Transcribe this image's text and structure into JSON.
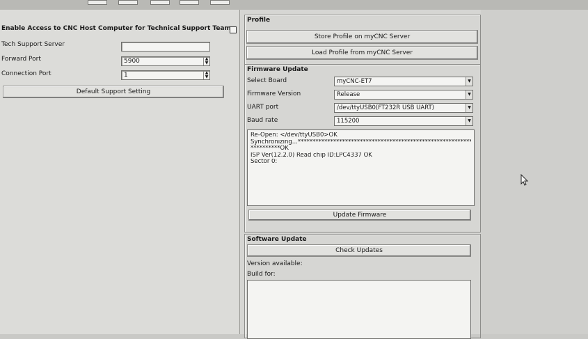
{
  "support": {
    "enable_label": "Enable Access to CNC Host Computer for Technical Support Team",
    "tech_server_label": "Tech Support Server",
    "tech_server_value": "",
    "forward_port_label": "Forward Port",
    "forward_port_value": "5900",
    "connection_port_label": "Connection Port",
    "connection_port_value": "1",
    "default_button": "Default Support Setting"
  },
  "profile": {
    "title": "Profile",
    "store_button": "Store Profile on myCNC Server",
    "load_button": "Load Profile from myCNC Server"
  },
  "firmware": {
    "title": "Firmware Update",
    "select_board_label": "Select Board",
    "select_board_value": "myCNC-ET7",
    "version_label": "Firmware Version",
    "version_value": "Release",
    "uart_label": "UART port",
    "uart_value": "/dev/ttyUSB0(FT232R USB UART)",
    "baud_label": "Baud rate",
    "baud_value": "115200",
    "log_lines": [
      "Re-Open: </dev/ttyUSB0>OK",
      "Synchronizing...*******************************************************************",
      "**********OK",
      "ISP Ver(12.2.0) Read chip ID:LPC4337  OK",
      "Sector 0:"
    ],
    "update_button": "Update Firmware"
  },
  "software": {
    "title": "Software Update",
    "check_button": "Check Updates",
    "version_label": "Version available:",
    "build_label": "Build for:"
  }
}
